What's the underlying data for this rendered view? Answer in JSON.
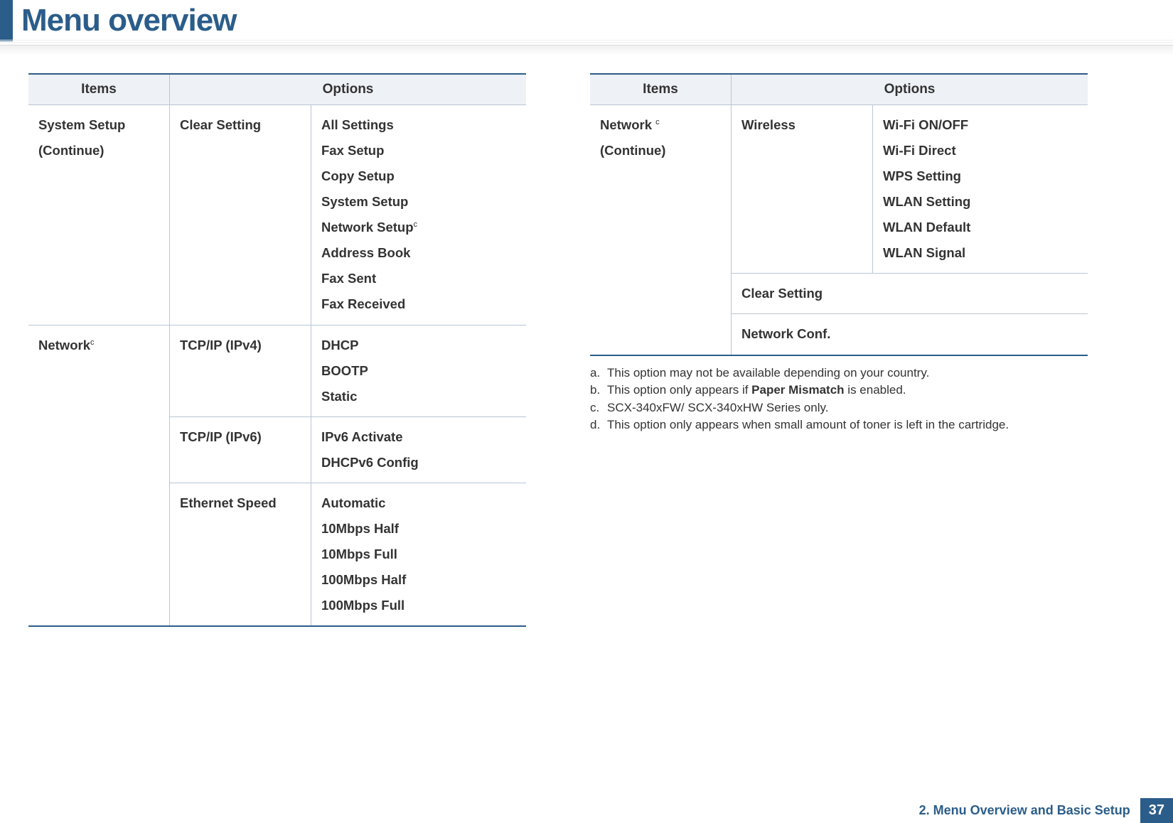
{
  "page_title": "Menu overview",
  "footer": {
    "chapter": "2.  Menu Overview and Basic Setup",
    "page_number": "37"
  },
  "table_headers": {
    "items": "Items",
    "options": "Options"
  },
  "left_table": {
    "rows": [
      {
        "item": "System Setup (Continue)",
        "sub": "Clear Setting",
        "options": [
          "All Settings",
          "Fax Setup",
          "Copy Setup",
          "System Setup",
          "",
          "Address Book",
          "Fax Sent",
          "Fax Received"
        ],
        "option_special": {
          "index": 4,
          "text": "Network Setup",
          "note": "c"
        }
      },
      {
        "item": "Network",
        "item_note": "c",
        "sub": "TCP/IP (IPv4)",
        "options": [
          "DHCP",
          "BOOTP",
          "Static"
        ]
      },
      {
        "item_continue": true,
        "sub": "TCP/IP (IPv6)",
        "options": [
          "IPv6 Activate",
          "DHCPv6 Config"
        ]
      },
      {
        "item_continue": true,
        "sub": "Ethernet Speed",
        "options": [
          "Automatic",
          "10Mbps Half",
          "10Mbps Full",
          "100Mbps Half",
          "100Mbps Full"
        ]
      }
    ]
  },
  "right_table": {
    "rows": [
      {
        "item": "Network ",
        "item_note": "c",
        "item_line2": "(Continue)",
        "sub": "Wireless",
        "options": [
          "Wi-Fi ON/OFF",
          "Wi-Fi Direct",
          "WPS Setting",
          "WLAN Setting",
          "WLAN Default",
          "WLAN Signal"
        ]
      },
      {
        "item_continue": true,
        "full": "Clear Setting"
      },
      {
        "item_continue": true,
        "full": "Network Conf."
      }
    ]
  },
  "footnotes": {
    "a": "This option may not be available depending on your country.",
    "b_pre": "This option only appears if ",
    "b_bold": "Paper Mismatch",
    "b_post": " is enabled.",
    "c": "SCX-340xFW/ SCX-340xHW Series only.",
    "d": "This option only appears when small amount of toner is left in the cartridge."
  },
  "labels": {
    "a": "a.",
    "b": "b.",
    "c": "c.",
    "d": "d."
  }
}
